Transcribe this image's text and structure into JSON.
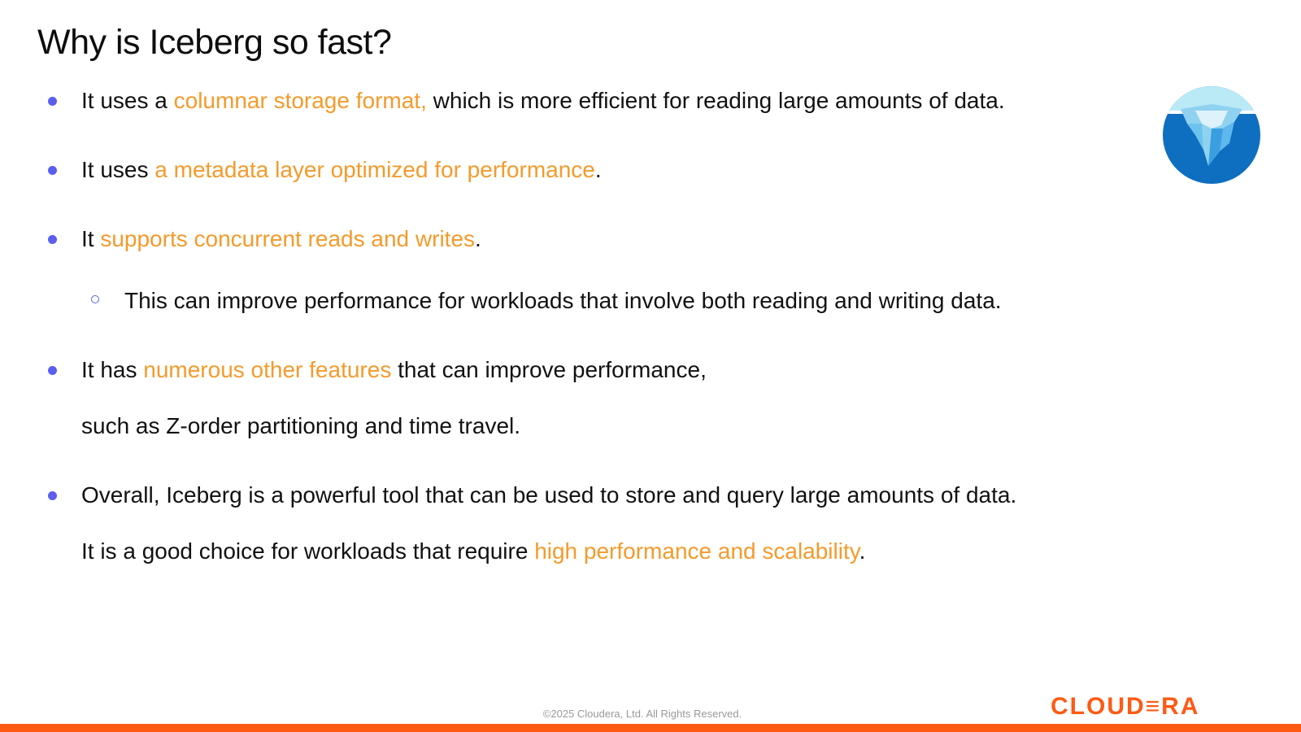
{
  "slide": {
    "title": "Why is Iceberg so fast?"
  },
  "bullets": [
    {
      "pre": "It uses a ",
      "highlight": "columnar storage format,",
      "post": " which is more efficient for reading large amounts of data."
    },
    {
      "pre": "It uses ",
      "highlight": "a metadata layer optimized for performance",
      "post": "."
    },
    {
      "pre": "It ",
      "highlight": "supports concurrent reads and writes",
      "post": "."
    },
    {
      "sub": "This can improve performance for workloads that involve both reading and writing data."
    },
    {
      "pre": "It has ",
      "highlight": "numerous other features",
      "post": " that can improve performance,",
      "continuation": "such as Z-order partitioning and time travel."
    },
    {
      "text": "Overall, Iceberg is a powerful tool that can be used to store and query large amounts of data.",
      "continuation_pre": "It is a good choice for workloads that require ",
      "continuation_highlight": "high performance and scalability",
      "continuation_post": "."
    }
  ],
  "footer": {
    "copyright": "©2025 Cloudera, Ltd. All Rights Reserved.",
    "brand": "CLOUD≡RA"
  },
  "colors": {
    "highlight": "#f59a2b",
    "bullet": "#5b5ef0",
    "brand": "#ff5a14"
  },
  "icons": {
    "iceberg_logo": "iceberg-logo-icon"
  }
}
